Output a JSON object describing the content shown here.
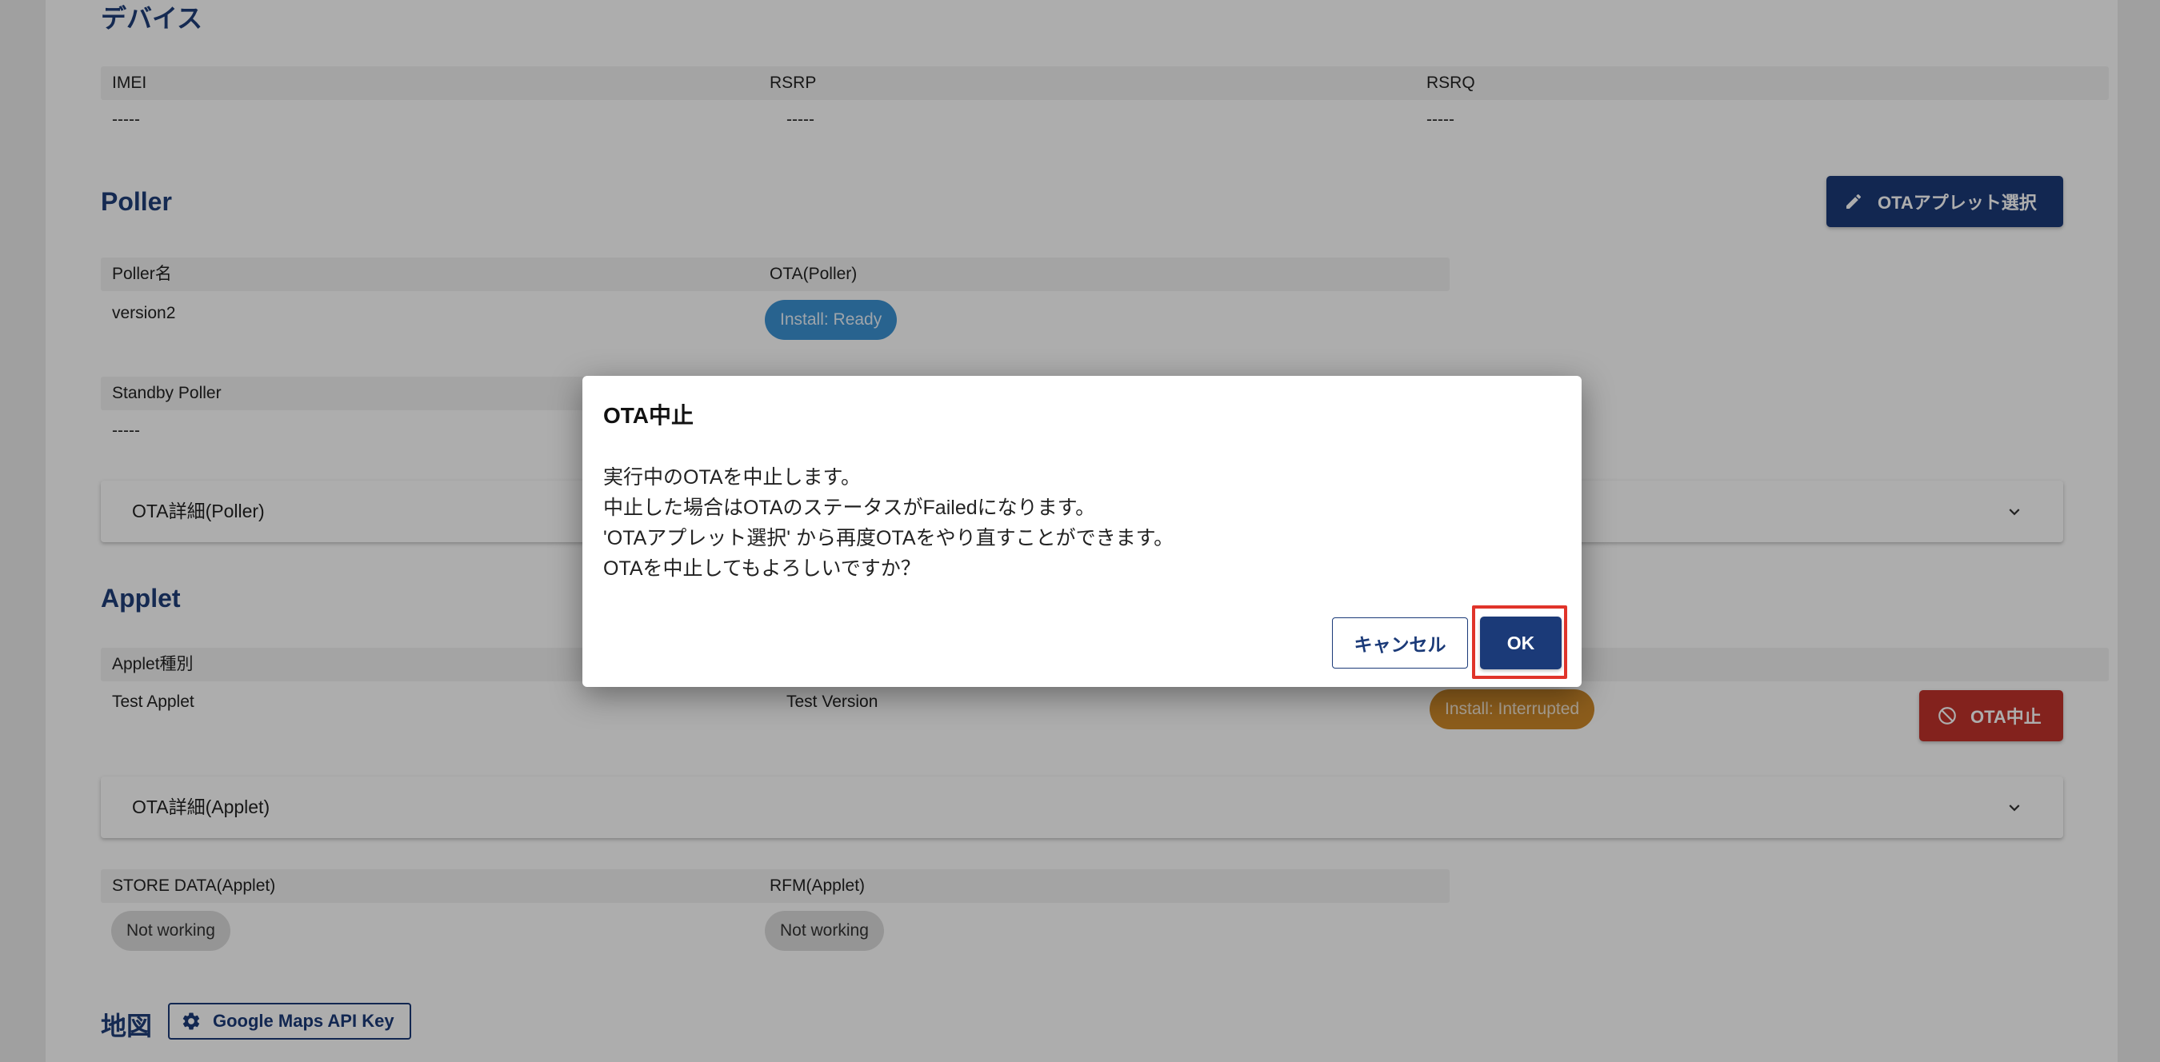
{
  "device": {
    "title": "デバイス",
    "fields": [
      {
        "label": "IMEI",
        "value": "-----"
      },
      {
        "label": "RSRP",
        "value": "-----"
      },
      {
        "label": "RSRQ",
        "value": "-----"
      }
    ]
  },
  "poller": {
    "title": "Poller",
    "select_button": "OTAアプレット選択",
    "name_label": "Poller名",
    "name_value": "version2",
    "ota_label": "OTA(Poller)",
    "ota_status": "Install: Ready",
    "standby_label": "Standby Poller",
    "standby_value": "-----",
    "detail_accordion": "OTA詳細(Poller)"
  },
  "applet": {
    "title": "Applet",
    "type_label": "Applet種別",
    "type_value": "Test Applet",
    "version_value": "Test Version",
    "ota_status": "Install: Interrupted",
    "abort_button": "OTA中止",
    "detail_accordion": "OTA詳細(Applet)",
    "store_data_label": "STORE DATA(Applet)",
    "store_data_status": "Not working",
    "rfm_label": "RFM(Applet)",
    "rfm_status": "Not working"
  },
  "map": {
    "title": "地図",
    "api_key_button": "Google Maps API Key"
  },
  "dialog": {
    "title": "OTA中止",
    "lines": [
      "実行中のOTAを中止します。",
      "中止した場合はOTAのステータスがFailedになります。",
      "'OTAアプレット選択' から再度OTAをやり直すことができます。",
      "OTAを中止してもよろしいですか？"
    ],
    "cancel_label": "キャンセル",
    "ok_label": "OK"
  },
  "colors": {
    "primary": "#1b3a78",
    "danger": "#c2332b",
    "chip_ready": "#3b93d3",
    "chip_interrupted": "#ce8a2a",
    "highlight": "#e0342a"
  }
}
